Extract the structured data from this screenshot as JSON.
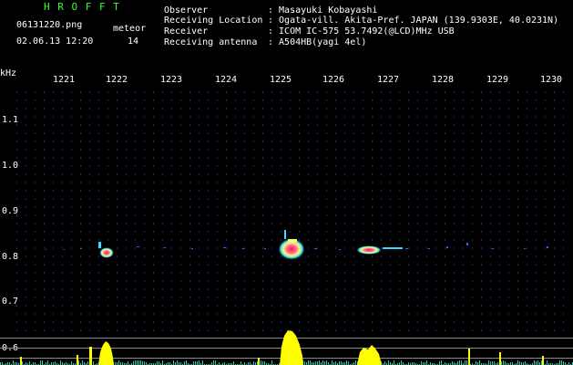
{
  "app": {
    "title": "H R O F F T",
    "file": "06131220.png",
    "datetime": "02.06.13 12:20",
    "count_label": "meteor",
    "count_value": "14"
  },
  "info": [
    {
      "label": "Observer",
      "value": ": Masayuki Kobayashi"
    },
    {
      "label": "Receiving Location",
      "value": ": Ogata-vill. Akita-Pref. JAPAN (139.9303E, 40.0231N)"
    },
    {
      "label": "Receiver",
      "value": ": ICOM IC-575 53.7492(@LCD)MHz USB"
    },
    {
      "label": "Receiving antenna",
      "value": ": A504HB(yagi 4el)"
    }
  ],
  "colors": {
    "title": "#33ff33",
    "header_text": "#ffffff",
    "axis_text": "#ffffff",
    "dot_grid": "#1a2a8a",
    "echo_core": "#ff2222",
    "echo_mid": "#ffff00",
    "echo_edge": "#33ddff",
    "histogram": "#ffff00",
    "baseline": "#22ccaa"
  },
  "axis": {
    "y_unit": "kHz",
    "y_ticks": [
      "1.1",
      "1.0",
      "0.9",
      "0.8",
      "0.7",
      "0.6"
    ],
    "x_ticks": [
      "1221",
      "1222",
      "1223",
      "1224",
      "1225",
      "1226",
      "1227",
      "1228",
      "1229",
      "1230"
    ]
  }
}
